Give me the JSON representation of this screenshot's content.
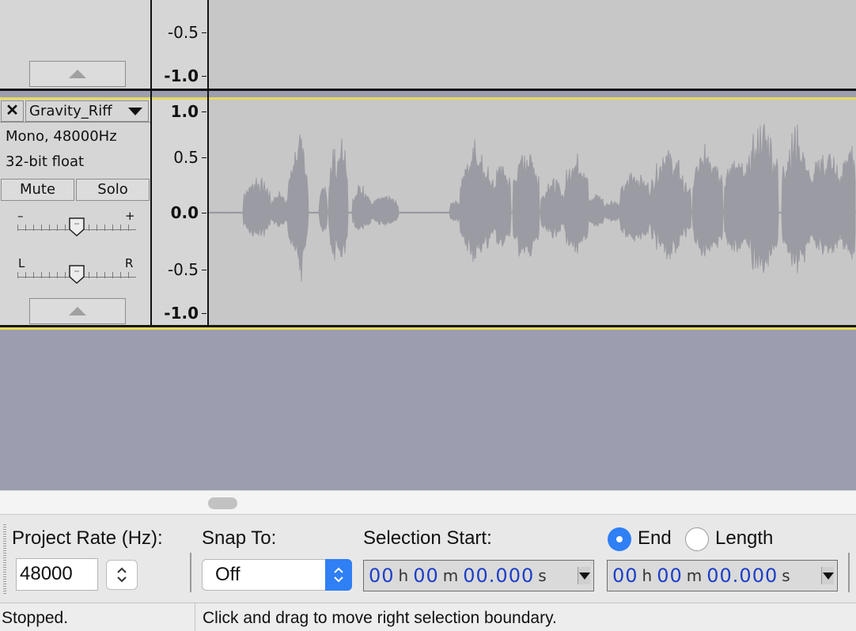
{
  "top_track": {
    "ticks": [
      "-0.5",
      "-1.0"
    ]
  },
  "track": {
    "name": "Gravity_Riff",
    "info_line1": "Mono, 48000Hz",
    "info_line2": "32-bit float",
    "mute_label": "Mute",
    "solo_label": "Solo",
    "gain_min_label": "–",
    "gain_max_label": "+",
    "pan_left_label": "L",
    "pan_right_label": "R",
    "gain_level": 0.5,
    "pan_level": 0.5,
    "ruler_ticks": [
      "1.0",
      "0.5",
      "0.0",
      "-0.5",
      "-1.0"
    ],
    "waveform_color": "#9b9ba3"
  },
  "selection_toolbar": {
    "project_rate_label": "Project Rate (Hz):",
    "project_rate_value": "48000",
    "snap_to_label": "Snap To:",
    "snap_to_value": "Off",
    "selection_start_label": "Selection Start:",
    "end_label": "End",
    "length_label": "Length",
    "end_selected": true,
    "start_time": {
      "h": "00",
      "h_unit": "h",
      "m": "00",
      "m_unit": "m",
      "s": "00.000",
      "s_unit": "s"
    },
    "end_time": {
      "h": "00",
      "h_unit": "h",
      "m": "00",
      "m_unit": "m",
      "s": "00.000",
      "s_unit": "s"
    },
    "accent_color": "#2f7ff5"
  },
  "status_bar": {
    "state": "Stopped.",
    "hint": "Click and drag to move right selection boundary."
  }
}
